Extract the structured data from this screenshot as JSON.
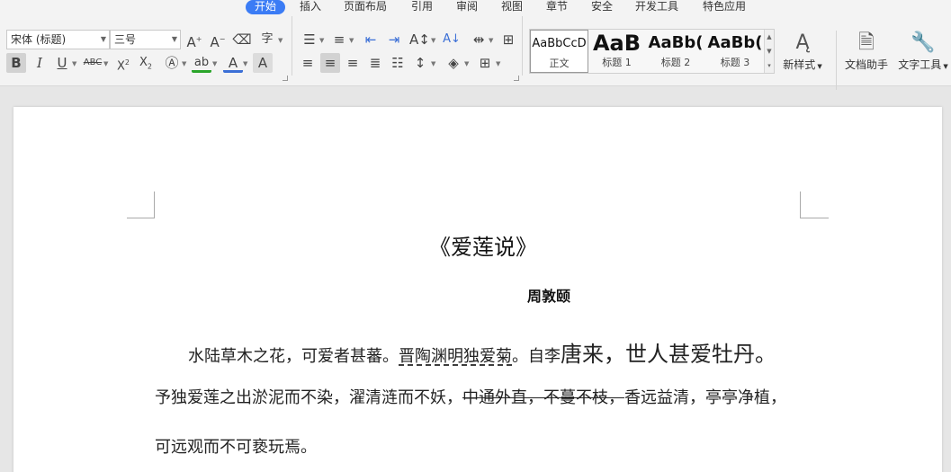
{
  "menu": {
    "tabs": [
      "开始",
      "插入",
      "页面布局",
      "引用",
      "审阅",
      "视图",
      "章节",
      "安全",
      "开发工具",
      "特色应用"
    ]
  },
  "ribbon": {
    "font_name": "宋体 (标题)",
    "font_size": "三号",
    "styles": [
      {
        "sample": "AaBbCcD",
        "name": "正文"
      },
      {
        "sample": "AaB",
        "name": "标题 1"
      },
      {
        "sample": "AaBb(",
        "name": "标题 2"
      },
      {
        "sample": "AaBb(",
        "name": "标题 3"
      }
    ],
    "new_style_label": "新样式",
    "doc_helper_label": "文档助手",
    "text_tools_label": "文字工具"
  },
  "document": {
    "title": "《爱莲说》",
    "author": "周敦颐",
    "line1": {
      "a": "水陆草木之花，可爱者甚蕃。",
      "b": "晋陶渊明独爱菊",
      "c": "。自李",
      "d": "唐来，世人甚爱牡丹。"
    },
    "line2": {
      "a": "予独爱莲之出淤泥而不染，濯清涟而不妖，",
      "b": "中通外直，不蔓不枝，",
      "c": "香远益清，亭亭净植，"
    },
    "line3": "可远观而不可亵玩焉。"
  },
  "colors": {
    "accent": "#3b7cf5",
    "highlight_green": "#2aa52a",
    "font_color_blue": "#3b6fd6"
  }
}
